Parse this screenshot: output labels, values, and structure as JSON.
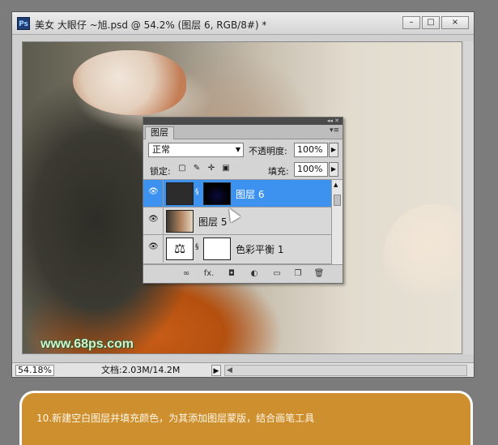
{
  "window": {
    "app_icon": "Ps",
    "title": "美女 大眼仔 ~旭.psd @ 54.2% (图层 6, RGB/8#) *",
    "buttons": [
      "–",
      "□",
      "×"
    ]
  },
  "canvas": {
    "watermark": "www.68ps.com"
  },
  "status_bar": {
    "zoom": "54.18%",
    "doc_info": "文档:2.03M/14.2M",
    "play": "▶"
  },
  "layers_panel": {
    "tab_label": "图层",
    "blend_mode": "正常",
    "opacity_label": "不透明度:",
    "opacity_value": "100%",
    "lock_label": "锁定:",
    "fill_label": "填充:",
    "fill_value": "100%",
    "layers": [
      {
        "name": "图层 6",
        "selected": true
      },
      {
        "name": "图层 5",
        "selected": false
      },
      {
        "name": "色彩平衡 1",
        "selected": false
      }
    ],
    "bottom_icons": [
      "link-icon",
      "fx-icon",
      "mask-icon",
      "adjustment-icon",
      "group-folder-icon",
      "new-layer-icon",
      "trash-icon"
    ],
    "bottom_labels": [
      "∞",
      "fx.",
      "◘",
      "◐",
      "▭",
      "❐",
      "🗑"
    ]
  },
  "banner": {
    "text": "10.新建空白图层并填充颜色，为其添加图层蒙版，结合画笔工具"
  }
}
